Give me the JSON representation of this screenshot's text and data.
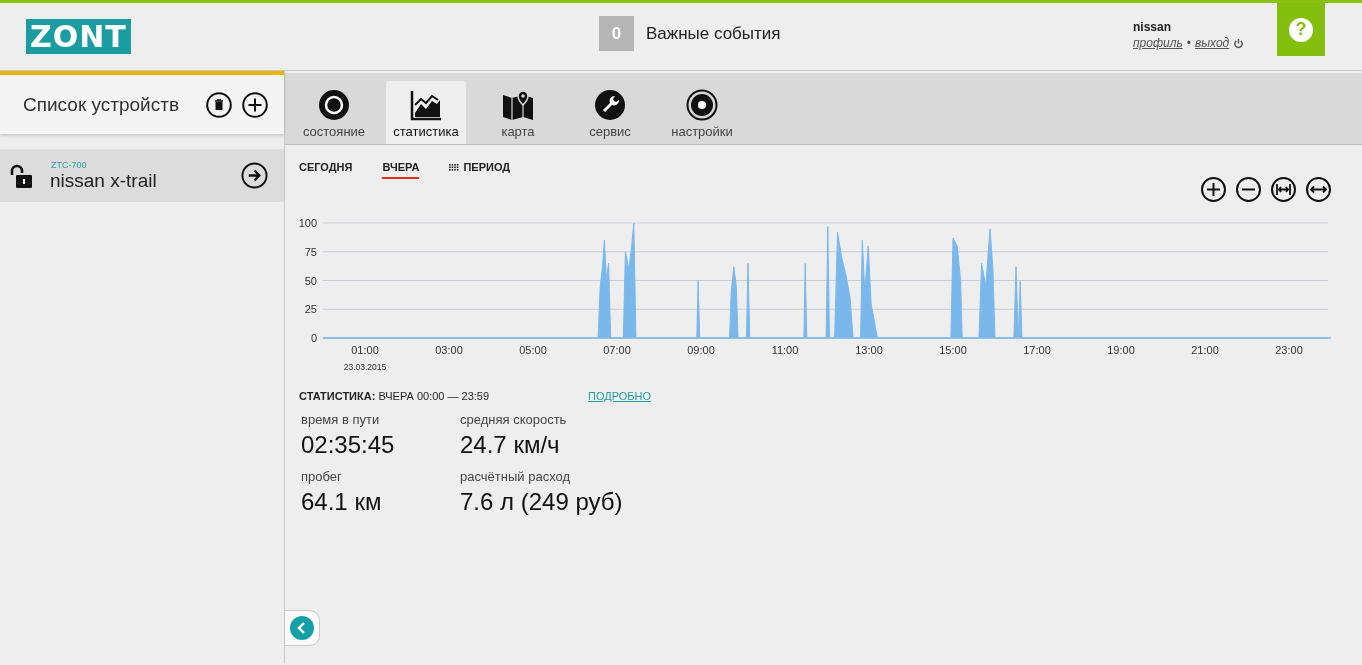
{
  "header": {
    "logo": "ZONT",
    "events": {
      "count": "0",
      "label": "Важные события"
    },
    "user": {
      "name": "nissan",
      "profile_link": "профиль",
      "separator": "•",
      "logout_link": "выход"
    },
    "help_glyph": "?"
  },
  "sidebar": {
    "title": "Список устройств",
    "devices": [
      {
        "model": "ZTC-700",
        "name": "nissan x-trail",
        "locked": false,
        "selected": true
      }
    ]
  },
  "tabs": [
    {
      "label": "состояние",
      "selected": false
    },
    {
      "label": "статистика",
      "selected": true
    },
    {
      "label": "карта",
      "selected": false
    },
    {
      "label": "сервис",
      "selected": false
    },
    {
      "label": "настройки",
      "selected": false
    }
  ],
  "periods": [
    {
      "label": "СЕГОДНЯ",
      "selected": false,
      "kind": "plain"
    },
    {
      "label": "ВЧЕРА",
      "selected": true,
      "kind": "plain"
    },
    {
      "label": "ПЕРИОД",
      "selected": false,
      "kind": "range"
    }
  ],
  "chart": {
    "date_label": "23.03.2015",
    "chart_data": {
      "type": "area",
      "grid": true,
      "xlim": [
        0,
        24
      ],
      "ylim": [
        0,
        100
      ],
      "yticks": [
        0,
        25,
        50,
        75,
        100
      ],
      "xticks": [
        {
          "value": 1,
          "label": "01:00"
        },
        {
          "value": 3,
          "label": "03:00"
        },
        {
          "value": 5,
          "label": "05:00"
        },
        {
          "value": 7,
          "label": "07:00"
        },
        {
          "value": 9,
          "label": "09:00"
        },
        {
          "value": 11,
          "label": "11:00"
        },
        {
          "value": 13,
          "label": "13:00"
        },
        {
          "value": 15,
          "label": "15:00"
        },
        {
          "value": 17,
          "label": "17:00"
        },
        {
          "value": 19,
          "label": "19:00"
        },
        {
          "value": 21,
          "label": "21:00"
        },
        {
          "value": 23,
          "label": "23:00"
        }
      ],
      "x": [
        0,
        6.55,
        6.6,
        6.65,
        6.7,
        6.75,
        6.8,
        6.85,
        7.15,
        7.2,
        7.28,
        7.35,
        7.4,
        7.45,
        8.9,
        8.93,
        8.97,
        9.68,
        9.72,
        9.78,
        9.84,
        9.88,
        10.08,
        10.12,
        10.16,
        11.45,
        11.48,
        11.52,
        11.98,
        12.02,
        12.06,
        12.18,
        12.25,
        12.35,
        12.45,
        12.55,
        12.62,
        12.8,
        12.84,
        12.9,
        12.98,
        13.05,
        13.15,
        13.2,
        14.95,
        15.0,
        15.1,
        15.18,
        15.22,
        15.62,
        15.68,
        15.78,
        15.88,
        15.95,
        16.0,
        16.45,
        16.5,
        16.56,
        16.6,
        16.64,
        24
      ],
      "series": [
        {
          "color": "#7ab8ec",
          "values": [
            0,
            0,
            45,
            60,
            85,
            50,
            65,
            0,
            0,
            75,
            60,
            80,
            100,
            0,
            0,
            50,
            0,
            0,
            40,
            62,
            45,
            0,
            0,
            65,
            0,
            0,
            65,
            0,
            0,
            97,
            0,
            0,
            92,
            70,
            55,
            35,
            0,
            0,
            85,
            40,
            80,
            30,
            10,
            0,
            0,
            87,
            80,
            50,
            0,
            0,
            65,
            45,
            95,
            60,
            0,
            0,
            62,
            0,
            50,
            0,
            0
          ]
        }
      ]
    }
  },
  "stats": {
    "heading": "**СТАТИСТИКА:** ВЧЕРА 00:00 — 23:59",
    "details_link": "ПОДРОБНО",
    "items": [
      {
        "label": "время в пути",
        "value": "02:35:45"
      },
      {
        "label": "средняя скорость",
        "value": "24.7 км/ч"
      },
      {
        "label": "пробег",
        "value": "64.1 км"
      },
      {
        "label": "расчётный расход",
        "value": "7.6 л (249 руб)"
      }
    ]
  }
}
